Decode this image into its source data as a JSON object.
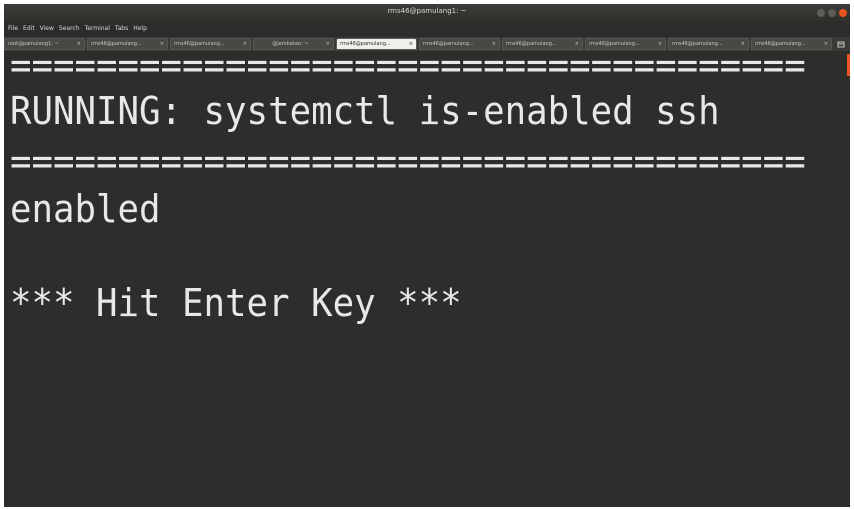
{
  "window": {
    "title": "rms46@pamulang1: ~"
  },
  "menu": [
    "File",
    "Edit",
    "View",
    "Search",
    "Terminal",
    "Tabs",
    "Help"
  ],
  "tabs": [
    {
      "label": "root@pamulang1: ~",
      "close": "×",
      "active": false
    },
    {
      "label": "rms46@pamulang...",
      "close": "×",
      "active": false
    },
    {
      "label": "rms46@pamulang...",
      "close": "×",
      "active": false
    },
    {
      "label": "@jembatan: ~",
      "close": "×",
      "active": false
    },
    {
      "label": "rms46@pamulang...",
      "close": "×",
      "active": true
    },
    {
      "label": "rms46@pamulang...",
      "close": "×",
      "active": false
    },
    {
      "label": "rms46@pamulang...",
      "close": "×",
      "active": false
    },
    {
      "label": "rms46@pamulang...",
      "close": "×",
      "active": false
    },
    {
      "label": "rms46@pamulang...",
      "close": "×",
      "active": false
    },
    {
      "label": "rms46@pamulang...",
      "close": "×",
      "active": false
    }
  ],
  "terminal": {
    "separator": "=====================================",
    "running": "RUNNING: systemctl is-enabled ssh",
    "status": "enabled",
    "prompt": "*** Hit Enter Key ***"
  },
  "colors": {
    "accent": "#e95420",
    "terminal_bg": "#2d2e2c",
    "terminal_fg": "#e8e8e6"
  }
}
